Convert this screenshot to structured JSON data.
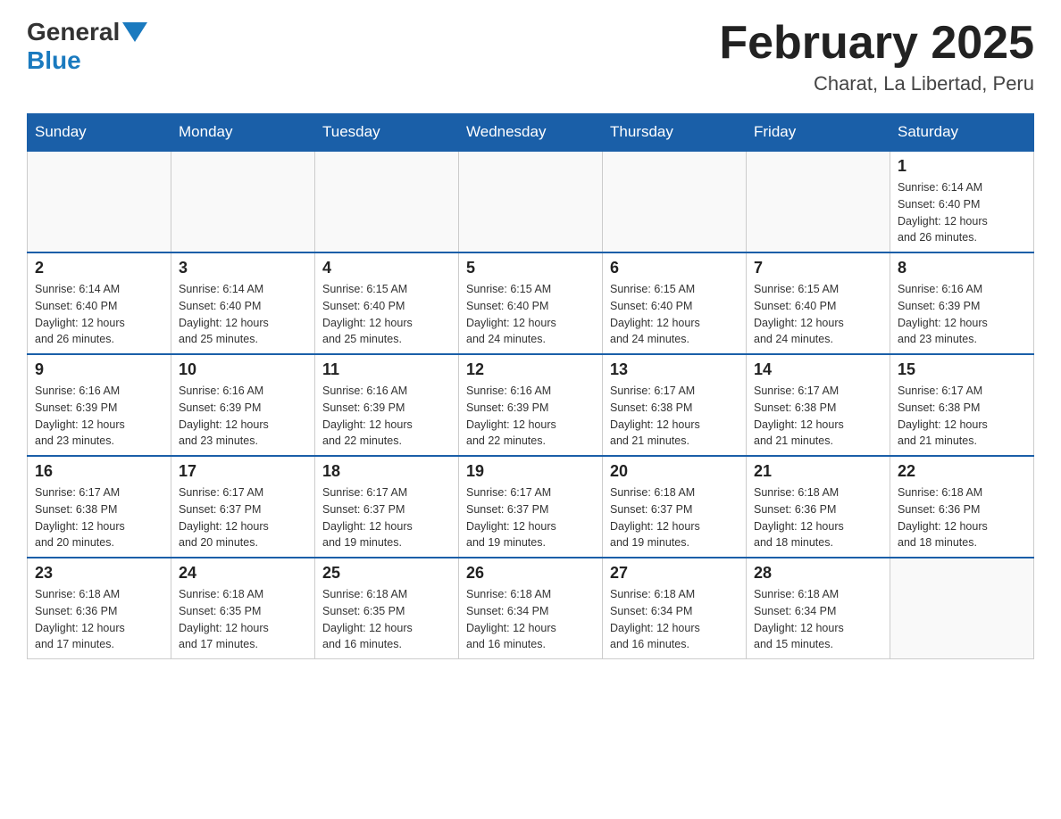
{
  "header": {
    "logo_general": "General",
    "logo_blue": "Blue",
    "title": "February 2025",
    "subtitle": "Charat, La Libertad, Peru"
  },
  "days_of_week": [
    "Sunday",
    "Monday",
    "Tuesday",
    "Wednesday",
    "Thursday",
    "Friday",
    "Saturday"
  ],
  "weeks": [
    [
      {
        "day": "",
        "info": ""
      },
      {
        "day": "",
        "info": ""
      },
      {
        "day": "",
        "info": ""
      },
      {
        "day": "",
        "info": ""
      },
      {
        "day": "",
        "info": ""
      },
      {
        "day": "",
        "info": ""
      },
      {
        "day": "1",
        "info": "Sunrise: 6:14 AM\nSunset: 6:40 PM\nDaylight: 12 hours\nand 26 minutes."
      }
    ],
    [
      {
        "day": "2",
        "info": "Sunrise: 6:14 AM\nSunset: 6:40 PM\nDaylight: 12 hours\nand 26 minutes."
      },
      {
        "day": "3",
        "info": "Sunrise: 6:14 AM\nSunset: 6:40 PM\nDaylight: 12 hours\nand 25 minutes."
      },
      {
        "day": "4",
        "info": "Sunrise: 6:15 AM\nSunset: 6:40 PM\nDaylight: 12 hours\nand 25 minutes."
      },
      {
        "day": "5",
        "info": "Sunrise: 6:15 AM\nSunset: 6:40 PM\nDaylight: 12 hours\nand 24 minutes."
      },
      {
        "day": "6",
        "info": "Sunrise: 6:15 AM\nSunset: 6:40 PM\nDaylight: 12 hours\nand 24 minutes."
      },
      {
        "day": "7",
        "info": "Sunrise: 6:15 AM\nSunset: 6:40 PM\nDaylight: 12 hours\nand 24 minutes."
      },
      {
        "day": "8",
        "info": "Sunrise: 6:16 AM\nSunset: 6:39 PM\nDaylight: 12 hours\nand 23 minutes."
      }
    ],
    [
      {
        "day": "9",
        "info": "Sunrise: 6:16 AM\nSunset: 6:39 PM\nDaylight: 12 hours\nand 23 minutes."
      },
      {
        "day": "10",
        "info": "Sunrise: 6:16 AM\nSunset: 6:39 PM\nDaylight: 12 hours\nand 23 minutes."
      },
      {
        "day": "11",
        "info": "Sunrise: 6:16 AM\nSunset: 6:39 PM\nDaylight: 12 hours\nand 22 minutes."
      },
      {
        "day": "12",
        "info": "Sunrise: 6:16 AM\nSunset: 6:39 PM\nDaylight: 12 hours\nand 22 minutes."
      },
      {
        "day": "13",
        "info": "Sunrise: 6:17 AM\nSunset: 6:38 PM\nDaylight: 12 hours\nand 21 minutes."
      },
      {
        "day": "14",
        "info": "Sunrise: 6:17 AM\nSunset: 6:38 PM\nDaylight: 12 hours\nand 21 minutes."
      },
      {
        "day": "15",
        "info": "Sunrise: 6:17 AM\nSunset: 6:38 PM\nDaylight: 12 hours\nand 21 minutes."
      }
    ],
    [
      {
        "day": "16",
        "info": "Sunrise: 6:17 AM\nSunset: 6:38 PM\nDaylight: 12 hours\nand 20 minutes."
      },
      {
        "day": "17",
        "info": "Sunrise: 6:17 AM\nSunset: 6:37 PM\nDaylight: 12 hours\nand 20 minutes."
      },
      {
        "day": "18",
        "info": "Sunrise: 6:17 AM\nSunset: 6:37 PM\nDaylight: 12 hours\nand 19 minutes."
      },
      {
        "day": "19",
        "info": "Sunrise: 6:17 AM\nSunset: 6:37 PM\nDaylight: 12 hours\nand 19 minutes."
      },
      {
        "day": "20",
        "info": "Sunrise: 6:18 AM\nSunset: 6:37 PM\nDaylight: 12 hours\nand 19 minutes."
      },
      {
        "day": "21",
        "info": "Sunrise: 6:18 AM\nSunset: 6:36 PM\nDaylight: 12 hours\nand 18 minutes."
      },
      {
        "day": "22",
        "info": "Sunrise: 6:18 AM\nSunset: 6:36 PM\nDaylight: 12 hours\nand 18 minutes."
      }
    ],
    [
      {
        "day": "23",
        "info": "Sunrise: 6:18 AM\nSunset: 6:36 PM\nDaylight: 12 hours\nand 17 minutes."
      },
      {
        "day": "24",
        "info": "Sunrise: 6:18 AM\nSunset: 6:35 PM\nDaylight: 12 hours\nand 17 minutes."
      },
      {
        "day": "25",
        "info": "Sunrise: 6:18 AM\nSunset: 6:35 PM\nDaylight: 12 hours\nand 16 minutes."
      },
      {
        "day": "26",
        "info": "Sunrise: 6:18 AM\nSunset: 6:34 PM\nDaylight: 12 hours\nand 16 minutes."
      },
      {
        "day": "27",
        "info": "Sunrise: 6:18 AM\nSunset: 6:34 PM\nDaylight: 12 hours\nand 16 minutes."
      },
      {
        "day": "28",
        "info": "Sunrise: 6:18 AM\nSunset: 6:34 PM\nDaylight: 12 hours\nand 15 minutes."
      },
      {
        "day": "",
        "info": ""
      }
    ]
  ]
}
